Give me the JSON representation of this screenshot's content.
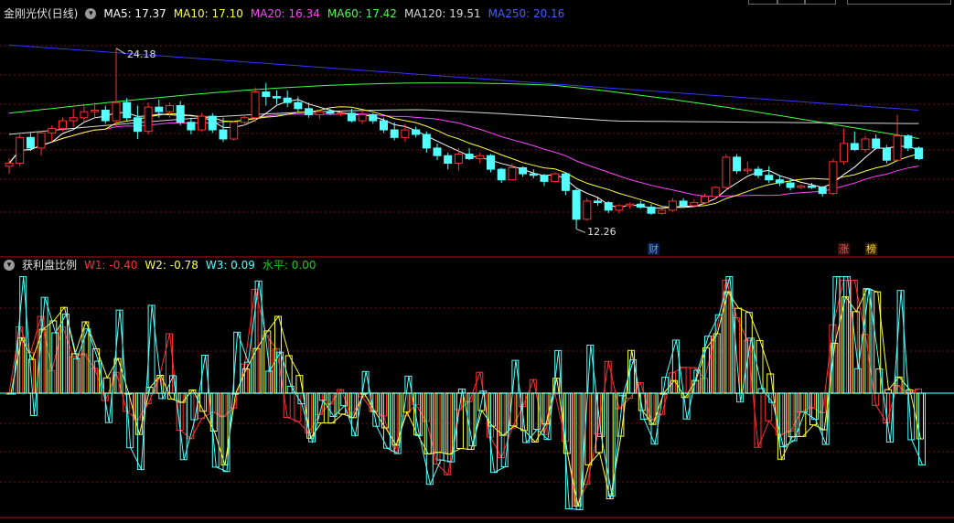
{
  "colors": {
    "up": "#ff3030",
    "down": "#54ffff",
    "ma5": "#ffffff",
    "ma10": "#ffff44",
    "ma20": "#ff44ff",
    "ma60": "#44ff44",
    "ma120": "#d8d8d8",
    "ma250": "#3333ff",
    "grid": "#7a1010",
    "sep": "#b01010",
    "w1": "#ff3030",
    "w2": "#ffff44",
    "w3": "#54ffff",
    "level": "#26c6c6"
  },
  "price_panel": {
    "title": "金刚光伏(日线)",
    "ma": [
      {
        "id": "ma5",
        "label": "MA5: 17.37"
      },
      {
        "id": "ma10",
        "label": "MA10: 17.10"
      },
      {
        "id": "ma20",
        "label": "MA20: 16.34"
      },
      {
        "id": "ma60",
        "label": "MA60: 17.42"
      },
      {
        "id": "ma120",
        "label": "MA120: 19.51"
      },
      {
        "id": "ma250",
        "label": "MA250: 20.16"
      }
    ],
    "high_label": "24.18",
    "low_label": "12.26",
    "tags": [
      {
        "text": "财",
        "color": "#5aa0ff"
      },
      {
        "text": "涨",
        "color": "#ff5050"
      },
      {
        "text": "榜",
        "color": "#ffd040"
      }
    ]
  },
  "indicator_panel": {
    "title": "获利盘比例",
    "legend": [
      {
        "id": "w1",
        "label": "W1: -0.40"
      },
      {
        "id": "w2",
        "label": "W2: -0.78"
      },
      {
        "id": "w3",
        "label": "W3: 0.09"
      },
      {
        "id": "level",
        "label": "水平: 0.00"
      }
    ]
  },
  "chart_data": [
    {
      "type": "candlestick",
      "ylim": [
        11.2,
        25.8
      ],
      "ohlc": [
        [
          16.4,
          16.9,
          15.9,
          16.6
        ],
        [
          16.6,
          18.6,
          16.4,
          18.3
        ],
        [
          18.3,
          18.6,
          17.4,
          17.6
        ],
        [
          17.6,
          18.7,
          17.1,
          18.6
        ],
        [
          18.6,
          19.1,
          18.0,
          18.9
        ],
        [
          18.9,
          19.6,
          18.7,
          19.4
        ],
        [
          19.4,
          20.2,
          19.0,
          19.6
        ],
        [
          19.6,
          20.4,
          19.3,
          20.0
        ],
        [
          20.0,
          20.6,
          19.6,
          20.1
        ],
        [
          20.1,
          20.4,
          19.2,
          19.4
        ],
        [
          19.4,
          24.18,
          19.0,
          20.6
        ],
        [
          20.6,
          20.9,
          19.4,
          19.6
        ],
        [
          19.6,
          20.4,
          18.2,
          18.7
        ],
        [
          18.7,
          20.6,
          18.5,
          20.3
        ],
        [
          20.3,
          20.8,
          19.6,
          20.0
        ],
        [
          20.0,
          20.6,
          19.6,
          20.4
        ],
        [
          20.4,
          20.7,
          19.1,
          19.3
        ],
        [
          19.3,
          19.6,
          18.5,
          18.8
        ],
        [
          18.8,
          19.9,
          18.7,
          19.7
        ],
        [
          19.7,
          19.9,
          18.6,
          18.8
        ],
        [
          18.8,
          19.6,
          18.0,
          18.2
        ],
        [
          18.2,
          19.4,
          18.1,
          19.3
        ],
        [
          19.3,
          19.8,
          19.1,
          19.6
        ],
        [
          19.6,
          21.6,
          19.3,
          21.3
        ],
        [
          21.3,
          21.9,
          20.4,
          21.0
        ],
        [
          21.0,
          21.4,
          20.5,
          20.9
        ],
        [
          20.9,
          21.4,
          20.3,
          20.6
        ],
        [
          20.6,
          21.0,
          20.0,
          20.2
        ],
        [
          20.2,
          20.6,
          19.6,
          19.8
        ],
        [
          19.8,
          20.1,
          19.5,
          20.0
        ],
        [
          20.0,
          20.2,
          19.8,
          19.9
        ],
        [
          19.9,
          20.1,
          19.7,
          19.9
        ],
        [
          19.9,
          20.2,
          19.3,
          19.4
        ],
        [
          19.4,
          20.1,
          19.2,
          19.8
        ],
        [
          19.8,
          19.9,
          19.2,
          19.4
        ],
        [
          19.4,
          19.6,
          18.6,
          18.8
        ],
        [
          18.8,
          19.3,
          18.1,
          18.3
        ],
        [
          18.3,
          19.2,
          18.0,
          18.8
        ],
        [
          18.8,
          19.0,
          18.3,
          18.5
        ],
        [
          18.5,
          18.7,
          17.3,
          17.6
        ],
        [
          17.6,
          17.9,
          16.8,
          17.1
        ],
        [
          17.1,
          17.3,
          16.2,
          16.6
        ],
        [
          16.6,
          17.6,
          16.1,
          17.2
        ],
        [
          17.2,
          17.6,
          16.8,
          16.9
        ],
        [
          16.9,
          17.3,
          16.6,
          17.1
        ],
        [
          17.1,
          17.2,
          16.0,
          16.2
        ],
        [
          16.2,
          16.3,
          15.3,
          15.5
        ],
        [
          15.5,
          16.6,
          15.5,
          16.3
        ],
        [
          16.3,
          16.4,
          15.7,
          15.9
        ],
        [
          15.9,
          16.2,
          15.6,
          15.8
        ],
        [
          15.8,
          15.9,
          15.1,
          15.4
        ],
        [
          15.4,
          16.0,
          15.4,
          15.9
        ],
        [
          15.9,
          16.0,
          14.5,
          14.8
        ],
        [
          14.8,
          14.9,
          12.26,
          12.9
        ],
        [
          12.9,
          14.3,
          12.8,
          14.1
        ],
        [
          14.1,
          14.4,
          13.8,
          14.0
        ],
        [
          14.0,
          14.1,
          13.3,
          13.5
        ],
        [
          13.5,
          13.9,
          13.3,
          13.8
        ],
        [
          13.8,
          14.0,
          13.6,
          13.9
        ],
        [
          13.9,
          14.1,
          13.6,
          13.7
        ],
        [
          13.7,
          13.9,
          13.2,
          13.3
        ],
        [
          13.3,
          13.6,
          13.2,
          13.5
        ],
        [
          13.5,
          14.3,
          13.4,
          14.1
        ],
        [
          14.1,
          14.3,
          13.7,
          13.8
        ],
        [
          13.8,
          14.2,
          13.7,
          14.0
        ],
        [
          14.0,
          14.6,
          13.9,
          14.4
        ],
        [
          14.4,
          15.1,
          14.2,
          15.0
        ],
        [
          15.0,
          17.2,
          14.8,
          17.0
        ],
        [
          17.0,
          17.2,
          15.9,
          16.1
        ],
        [
          16.1,
          16.7,
          15.9,
          16.2
        ],
        [
          16.2,
          16.4,
          15.6,
          15.8
        ],
        [
          15.8,
          16.4,
          15.3,
          15.5
        ],
        [
          15.5,
          15.8,
          15.1,
          15.3
        ],
        [
          15.3,
          15.6,
          14.8,
          15.0
        ],
        [
          15.0,
          15.2,
          14.9,
          15.1
        ],
        [
          15.1,
          15.3,
          14.9,
          15.0
        ],
        [
          15.0,
          15.1,
          14.4,
          14.6
        ],
        [
          14.6,
          16.9,
          14.5,
          16.7
        ],
        [
          16.7,
          18.9,
          16.5,
          17.9
        ],
        [
          17.9,
          18.7,
          17.4,
          17.5
        ],
        [
          17.5,
          18.4,
          17.3,
          18.2
        ],
        [
          18.2,
          18.5,
          17.5,
          17.6
        ],
        [
          17.6,
          17.8,
          16.6,
          16.8
        ],
        [
          16.8,
          19.8,
          16.7,
          18.4
        ],
        [
          18.4,
          18.5,
          17.4,
          17.6
        ],
        [
          17.6,
          17.7,
          16.8,
          16.9
        ]
      ]
    },
    {
      "type": "bar",
      "series_names": [
        "W1",
        "W2",
        "W3"
      ],
      "ylim": [
        -1.0,
        1.0
      ]
    }
  ]
}
